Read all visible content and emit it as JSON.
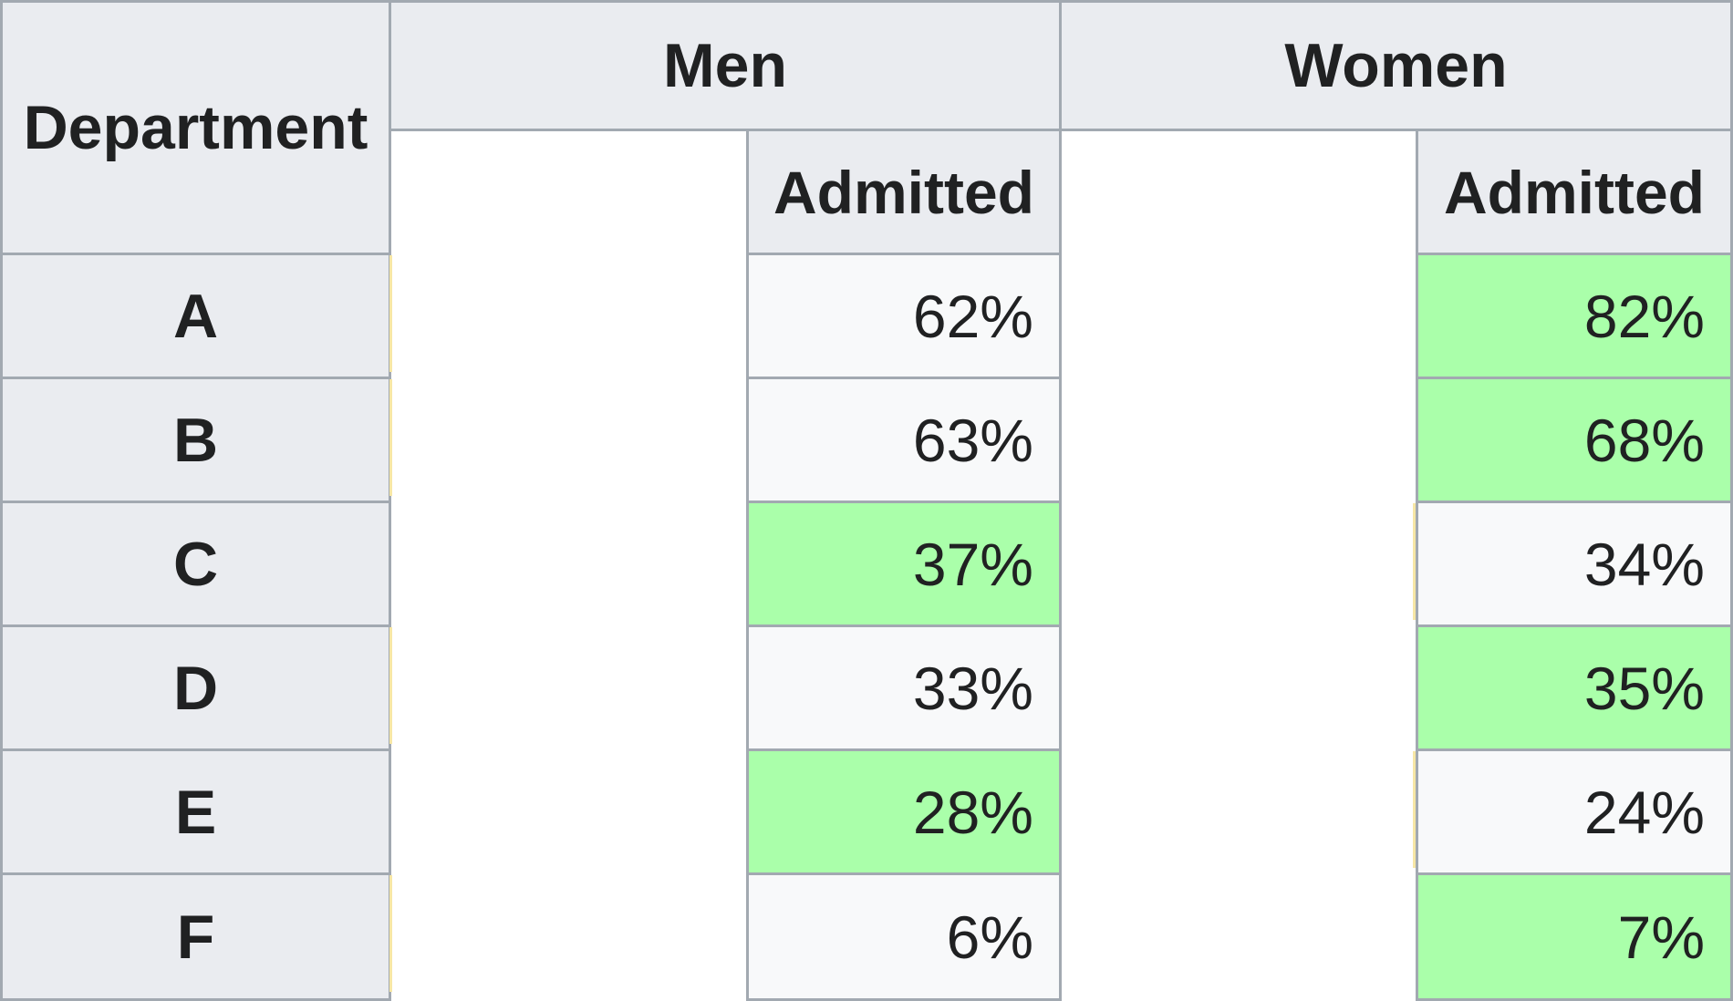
{
  "table": {
    "header": {
      "department": "Department",
      "men": "Men",
      "women": "Women",
      "men_admitted": "Admitted",
      "women_admitted": "Admitted"
    },
    "rows": [
      {
        "department": "A",
        "men_admitted": "62%",
        "women_admitted": "82%",
        "higher": "women"
      },
      {
        "department": "B",
        "men_admitted": "63%",
        "women_admitted": "68%",
        "higher": "women"
      },
      {
        "department": "C",
        "men_admitted": "37%",
        "women_admitted": "34%",
        "higher": "men"
      },
      {
        "department": "D",
        "men_admitted": "33%",
        "women_admitted": "35%",
        "higher": "women"
      },
      {
        "department": "E",
        "men_admitted": "28%",
        "women_admitted": "24%",
        "higher": "men"
      },
      {
        "department": "F",
        "men_admitted": "6%",
        "women_admitted": "7%",
        "higher": "women"
      }
    ],
    "colors": {
      "header_bg": "#eaecf0",
      "cell_bg": "#f8f9fa",
      "highlight_bg": "#aaffaa",
      "border": "#a2a9b1"
    }
  }
}
